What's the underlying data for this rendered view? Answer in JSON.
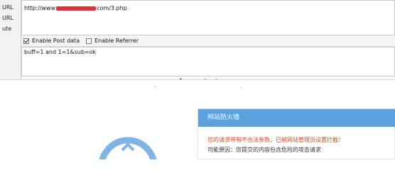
{
  "sidebar": {
    "labels": [
      "URL",
      "URL",
      "ute"
    ]
  },
  "url_box": {
    "prefix": "http://www",
    "suffix": "com/3.php"
  },
  "options": {
    "enable_post_data": {
      "label": "Enable Post data",
      "checked": true
    },
    "enable_referrer": {
      "label": "Enable Referrer",
      "checked": false
    }
  },
  "post_data": {
    "value": "buff=1 and 1=1&sub=ok"
  },
  "firewall": {
    "title": "网站防火墙",
    "message": "您的请求带有不合法参数，已被网站管理员设置拦截！",
    "reason": "可能原因：您提交的内容包含危险的攻击请求"
  },
  "colors": {
    "redaction": "#e0303a",
    "firewall_header": "#5aa2df",
    "warning_text": "#e4481e",
    "shield": "#7fb5e6"
  },
  "icons": {
    "shield": "shield-icon"
  }
}
